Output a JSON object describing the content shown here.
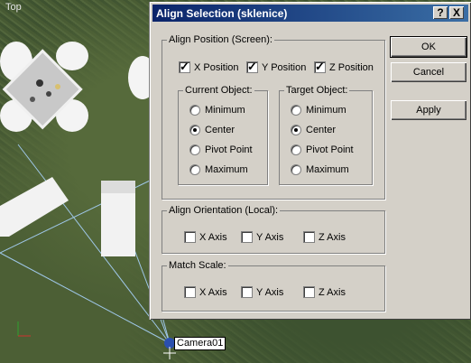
{
  "viewport": {
    "label": "Top",
    "camera_label": "Camera01"
  },
  "dialog": {
    "title": "Align Selection (sklenice)",
    "help_glyph": "?",
    "close_glyph": "X",
    "align_position": {
      "legend": "Align Position (Screen):",
      "x_label": "X Position",
      "x_checked": true,
      "y_label": "Y Position",
      "y_checked": true,
      "z_label": "Z Position",
      "z_checked": true
    },
    "current_object": {
      "legend": "Current Object:",
      "options": [
        "Minimum",
        "Center",
        "Pivot Point",
        "Maximum"
      ],
      "selected": "Center"
    },
    "target_object": {
      "legend": "Target Object:",
      "options": [
        "Minimum",
        "Center",
        "Pivot Point",
        "Maximum"
      ],
      "selected": "Center"
    },
    "align_orientation": {
      "legend": "Align Orientation (Local):",
      "x_label": "X Axis",
      "y_label": "Y Axis",
      "z_label": "Z Axis"
    },
    "match_scale": {
      "legend": "Match Scale:",
      "x_label": "X Axis",
      "y_label": "Y Axis",
      "z_label": "Z Axis"
    },
    "buttons": {
      "ok": "OK",
      "cancel": "Cancel",
      "apply": "Apply"
    }
  }
}
